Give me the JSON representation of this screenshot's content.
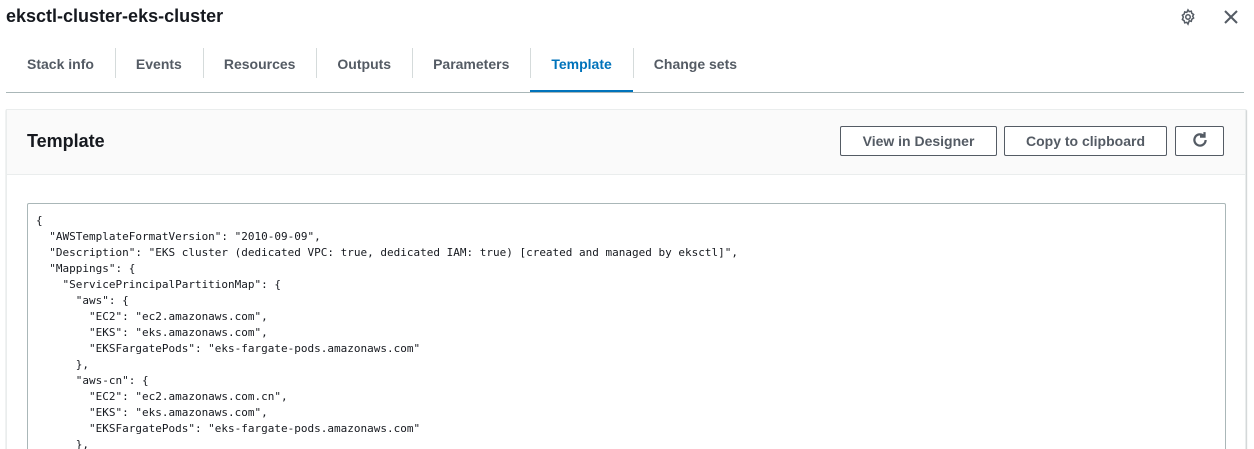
{
  "header": {
    "title": "eksctl-cluster-eks-cluster"
  },
  "tabs": [
    {
      "label": "Stack info",
      "active": false
    },
    {
      "label": "Events",
      "active": false
    },
    {
      "label": "Resources",
      "active": false
    },
    {
      "label": "Outputs",
      "active": false
    },
    {
      "label": "Parameters",
      "active": false
    },
    {
      "label": "Template",
      "active": true
    },
    {
      "label": "Change sets",
      "active": false
    }
  ],
  "panel": {
    "title": "Template",
    "view_designer_label": "View in Designer",
    "copy_label": "Copy to clipboard",
    "refresh_icon": "refresh-icon"
  },
  "code_lines": [
    "{",
    "  \"AWSTemplateFormatVersion\": \"2010-09-09\",",
    "  \"Description\": \"EKS cluster (dedicated VPC: true, dedicated IAM: true) [created and managed by eksctl]\",",
    "  \"Mappings\": {",
    "    \"ServicePrincipalPartitionMap\": {",
    "      \"aws\": {",
    "        \"EC2\": \"ec2.amazonaws.com\",",
    "        \"EKS\": \"eks.amazonaws.com\",",
    "        \"EKSFargatePods\": \"eks-fargate-pods.amazonaws.com\"",
    "      },",
    "      \"aws-cn\": {",
    "        \"EC2\": \"ec2.amazonaws.com.cn\",",
    "        \"EKS\": \"eks.amazonaws.com\",",
    "        \"EKSFargatePods\": \"eks-fargate-pods.amazonaws.com\"",
    "      },"
  ],
  "colors": {
    "accent": "#0073bb",
    "text": "#16191f",
    "muted": "#545b64"
  }
}
